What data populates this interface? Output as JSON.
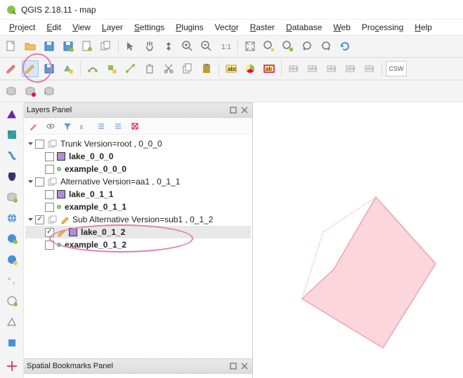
{
  "title": "QGIS 2.18.11 - map",
  "menus": [
    "Project",
    "Edit",
    "View",
    "Layer",
    "Settings",
    "Plugins",
    "Vector",
    "Raster",
    "Database",
    "Web",
    "Processing",
    "Help"
  ],
  "csw_label": "CSW",
  "layers_panel": {
    "title": "Layers Panel",
    "groups": [
      {
        "label": "Trunk Version=root , 0_0_0",
        "checked": false,
        "expanded": true,
        "layers": [
          {
            "name": "lake_0_0_0",
            "type": "poly",
            "checked": false,
            "bold": true
          },
          {
            "name": "example_0_0_0",
            "type": "point",
            "checked": false,
            "bold": true
          }
        ]
      },
      {
        "label": "Alternative Version=aa1 , 0_1_1",
        "checked": false,
        "expanded": true,
        "layers": [
          {
            "name": "lake_0_1_1",
            "type": "poly",
            "checked": false,
            "bold": true
          },
          {
            "name": "example_0_1_1",
            "type": "point",
            "checked": false,
            "bold": true
          }
        ]
      },
      {
        "label": "Sub Alternative Version=sub1 , 0_1_2",
        "checked": true,
        "expanded": true,
        "editing": true,
        "layers": [
          {
            "name": "lake_0_1_2",
            "type": "poly",
            "checked": true,
            "bold": true,
            "selected": true,
            "editing": true
          },
          {
            "name": "example_0_1_2",
            "type": "point",
            "checked": false,
            "bold": true
          }
        ]
      }
    ]
  },
  "bookmarks_panel": {
    "title": "Spatial Bookmarks Panel"
  }
}
